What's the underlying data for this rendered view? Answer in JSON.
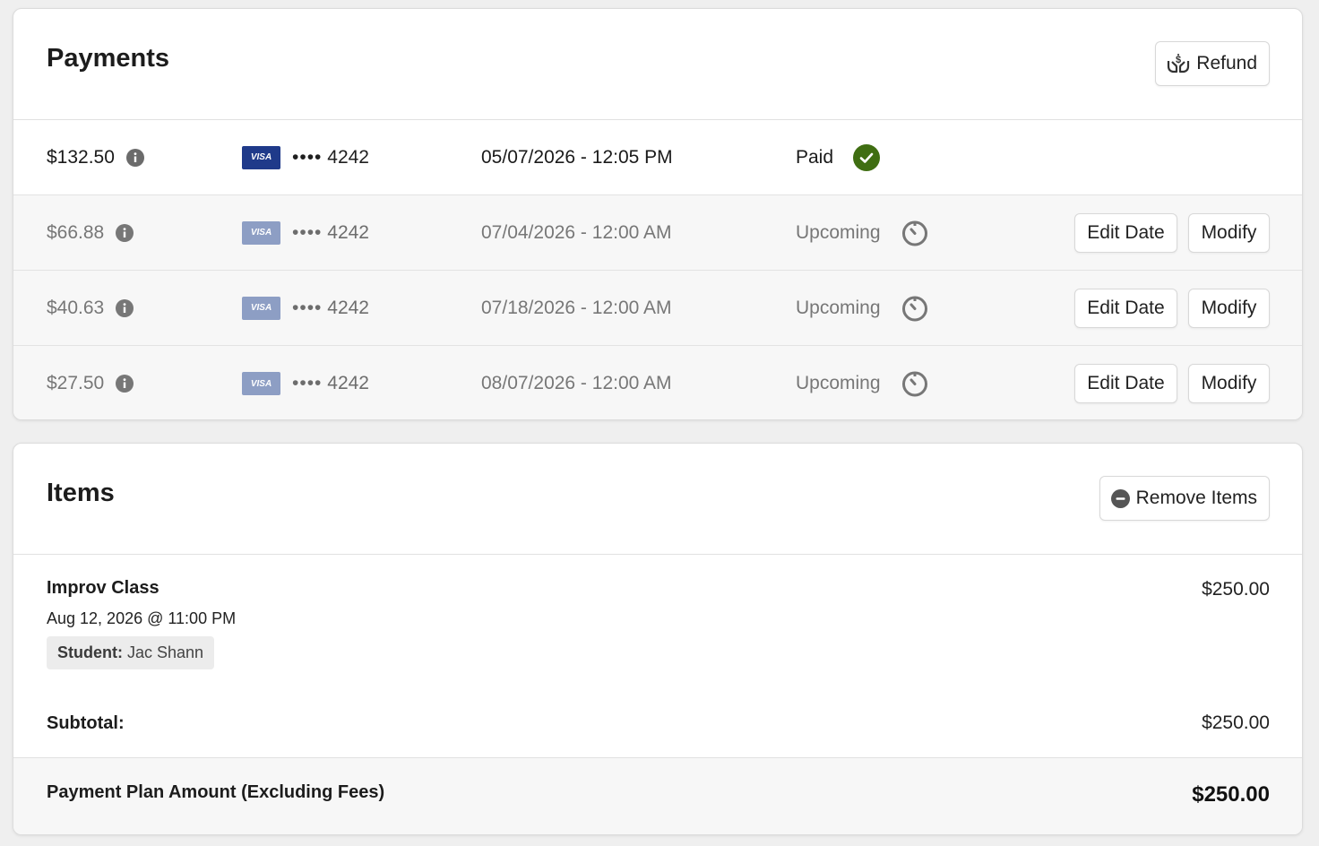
{
  "payments": {
    "title": "Payments",
    "refund_label": "Refund",
    "rows": [
      {
        "amount": "$132.50",
        "card_brand": "VISA",
        "card_dots": "••••",
        "card_last4": "4242",
        "date": "05/07/2026 - 12:05 PM",
        "status": "Paid",
        "status_icon": "check-circle-icon"
      },
      {
        "amount": "$66.88",
        "card_brand": "VISA",
        "card_dots": "••••",
        "card_last4": "4242",
        "date": "07/04/2026 - 12:00 AM",
        "status": "Upcoming",
        "status_icon": "timer-icon",
        "edit_label": "Edit Date",
        "modify_label": "Modify"
      },
      {
        "amount": "$40.63",
        "card_brand": "VISA",
        "card_dots": "••••",
        "card_last4": "4242",
        "date": "07/18/2026 - 12:00 AM",
        "status": "Upcoming",
        "status_icon": "timer-icon",
        "edit_label": "Edit Date",
        "modify_label": "Modify"
      },
      {
        "amount": "$27.50",
        "card_brand": "VISA",
        "card_dots": "••••",
        "card_last4": "4242",
        "date": "08/07/2026 - 12:00 AM",
        "status": "Upcoming",
        "status_icon": "timer-icon",
        "edit_label": "Edit Date",
        "modify_label": "Modify"
      }
    ]
  },
  "items": {
    "title": "Items",
    "remove_label": "Remove Items",
    "list": [
      {
        "name": "Improv Class",
        "date": "Aug 12, 2026 @ 11:00 PM",
        "student_label": "Student:",
        "student_name": "Jac Shann",
        "price": "$250.00"
      }
    ],
    "subtotal_label": "Subtotal:",
    "subtotal_value": "$250.00",
    "plan_label": "Payment Plan Amount (Excluding Fees)",
    "plan_value": "$250.00"
  },
  "colors": {
    "paid_green": "#3f6e12",
    "visa_blue": "#1f3a8a",
    "visa_blue_faded": "#8d9ec4"
  }
}
